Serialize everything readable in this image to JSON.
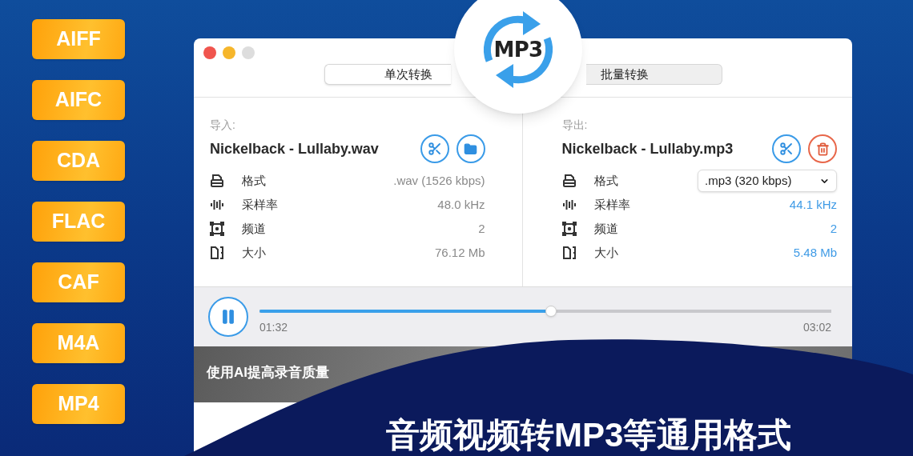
{
  "format_badges": [
    "AIFF",
    "AIFC",
    "CDA",
    "FLAC",
    "CAF",
    "M4A",
    "MP4"
  ],
  "window": {
    "tabs": [
      {
        "label": "单次转换",
        "selected": true
      },
      {
        "label": "批量转换",
        "selected": false
      }
    ],
    "logo": {
      "text": "MP3"
    },
    "panels": [
      {
        "label": "导入:",
        "filename": "Nickelback - Lullaby.wav",
        "actions": [
          {
            "kind": "cut"
          },
          {
            "kind": "folder"
          }
        ],
        "rows": [
          {
            "kind": "format",
            "label": "格式",
            "value": {
              "kind": "plain",
              "text": ".wav (1526 kbps)"
            }
          },
          {
            "kind": "sample_rate",
            "label": "采样率",
            "value": {
              "kind": "plain",
              "text": "48.0 kHz"
            }
          },
          {
            "kind": "channels",
            "label": "频道",
            "value": {
              "kind": "plain",
              "text": "2"
            }
          },
          {
            "kind": "size",
            "label": "大小",
            "value": {
              "kind": "plain",
              "text": "76.12 Mb"
            }
          }
        ]
      },
      {
        "label": "导出:",
        "filename": "Nickelback - Lullaby.mp3",
        "actions": [
          {
            "kind": "cut"
          },
          {
            "kind": "delete"
          }
        ],
        "rows": [
          {
            "kind": "format",
            "label": "格式",
            "value": {
              "kind": "dropdown",
              "text": ".mp3 (320 kbps)"
            }
          },
          {
            "kind": "sample_rate",
            "label": "采样率",
            "value": {
              "kind": "converted",
              "text": "44.1 kHz"
            }
          },
          {
            "kind": "channels",
            "label": "频道",
            "value": {
              "kind": "converted",
              "text": "2"
            }
          },
          {
            "kind": "size",
            "label": "大小",
            "value": {
              "kind": "converted",
              "text": "5.48 Mb"
            }
          }
        ]
      }
    ],
    "player": {
      "playing": true,
      "level": 0.51,
      "elapsed": "01:32",
      "total": "03:02"
    },
    "feature_banner": {
      "title": "使用AI提高录音质量"
    }
  },
  "headline": "音频视频转MP3等通用格式"
}
